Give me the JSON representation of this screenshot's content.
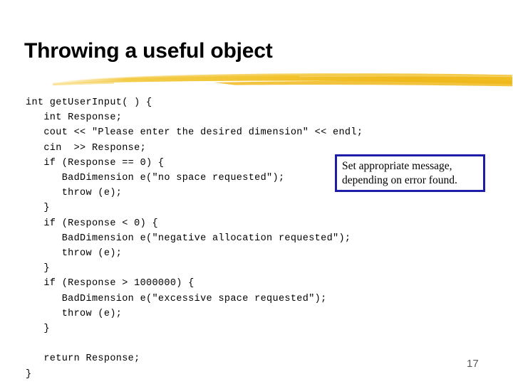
{
  "slide": {
    "title": "Throwing a useful object",
    "page_number": "17",
    "background_color": "#ffffff",
    "title_color": "#000000",
    "underline_color": "#f2c431",
    "underline_icon": "brush-stroke-divider"
  },
  "code": {
    "language": "cpp",
    "lines": [
      "int getUserInput( ) {",
      "   int Response;",
      "   cout << \"Please enter the desired dimension\" << endl;",
      "   cin  >> Response;",
      "   if (Response == 0) {",
      "      BadDimension e(\"no space requested\");",
      "      throw (e);",
      "   }",
      "   if (Response < 0) {",
      "      BadDimension e(\"negative allocation requested\");",
      "      throw (e);",
      "   }",
      "   if (Response > 1000000) {",
      "      BadDimension e(\"excessive space requested\");",
      "      throw (e);",
      "   }",
      "",
      "   return Response;",
      "}"
    ]
  },
  "callout": {
    "border_color": "#1d1da8",
    "background_color": "#ffffff",
    "text_color": "#000000",
    "lines": [
      "Set appropriate message,",
      "depending on error found."
    ]
  }
}
